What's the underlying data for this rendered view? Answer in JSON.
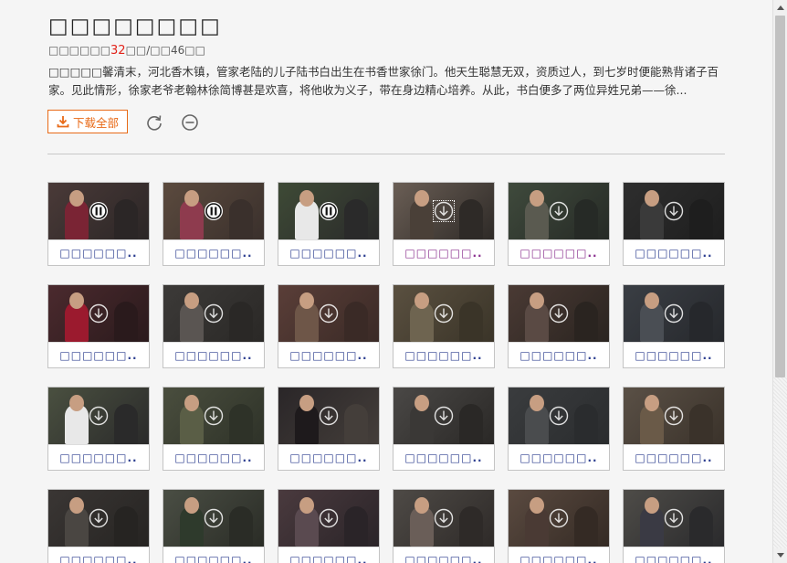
{
  "header": {
    "title": "□□□□□□□□",
    "meta_prefix": "□□□□□□",
    "meta_count": "32",
    "meta_mid": "□□/□□",
    "meta_total": "46",
    "meta_suffix": "□□",
    "description": "□□□□□馨清末，河北香木镇，管家老陆的儿子陆书白出生在书香世家徐门。他天生聪慧无双，资质过人，到七岁时便能熟背诸子百家。见此情形，徐家老爷老翰林徐简博甚是欢喜，将他收为义子，带在身边精心培养。从此，书白便多了两位异姓兄弟——徐..."
  },
  "toolbar": {
    "download_all_label": "下载全部",
    "download_icon": "download-icon",
    "refresh_icon": "refresh-icon",
    "remove_icon": "minus-circle-icon",
    "accent_color": "#e86a17"
  },
  "episodes": [
    {
      "label": "□□□□□□..",
      "state": "playing",
      "visited": false
    },
    {
      "label": "□□□□□□..",
      "state": "playing",
      "visited": false
    },
    {
      "label": "□□□□□□..",
      "state": "playing",
      "visited": false
    },
    {
      "label": "□□□□□□..",
      "state": "download",
      "visited": true
    },
    {
      "label": "□□□□□□..",
      "state": "download",
      "visited": true
    },
    {
      "label": "□□□□□□..",
      "state": "download",
      "visited": false
    },
    {
      "label": "□□□□□□..",
      "state": "download",
      "visited": false
    },
    {
      "label": "□□□□□□..",
      "state": "download",
      "visited": false
    },
    {
      "label": "□□□□□□..",
      "state": "download",
      "visited": false
    },
    {
      "label": "□□□□□□..",
      "state": "download",
      "visited": false
    },
    {
      "label": "□□□□□□..",
      "state": "download",
      "visited": false
    },
    {
      "label": "□□□□□□..",
      "state": "download",
      "visited": false
    },
    {
      "label": "□□□□□□..",
      "state": "download",
      "visited": false
    },
    {
      "label": "□□□□□□..",
      "state": "download",
      "visited": false
    },
    {
      "label": "□□□□□□..",
      "state": "download",
      "visited": false
    },
    {
      "label": "□□□□□□..",
      "state": "download",
      "visited": false
    },
    {
      "label": "□□□□□□..",
      "state": "download",
      "visited": false
    },
    {
      "label": "□□□□□□..",
      "state": "download",
      "visited": false
    },
    {
      "label": "□□□□□□..",
      "state": "download",
      "visited": false
    },
    {
      "label": "□□□□□□..",
      "state": "download",
      "visited": false
    },
    {
      "label": "□□□□□□..",
      "state": "download",
      "visited": false
    },
    {
      "label": "□□□□□□..",
      "state": "download",
      "visited": false
    },
    {
      "label": "□□□□□□..",
      "state": "download",
      "visited": false
    },
    {
      "label": "□□□□□□..",
      "state": "download",
      "visited": false
    }
  ],
  "colors": {
    "caption_link": "#2b3d8f",
    "caption_visited": "#8a2f8e",
    "count_highlight": "#e2231a"
  }
}
